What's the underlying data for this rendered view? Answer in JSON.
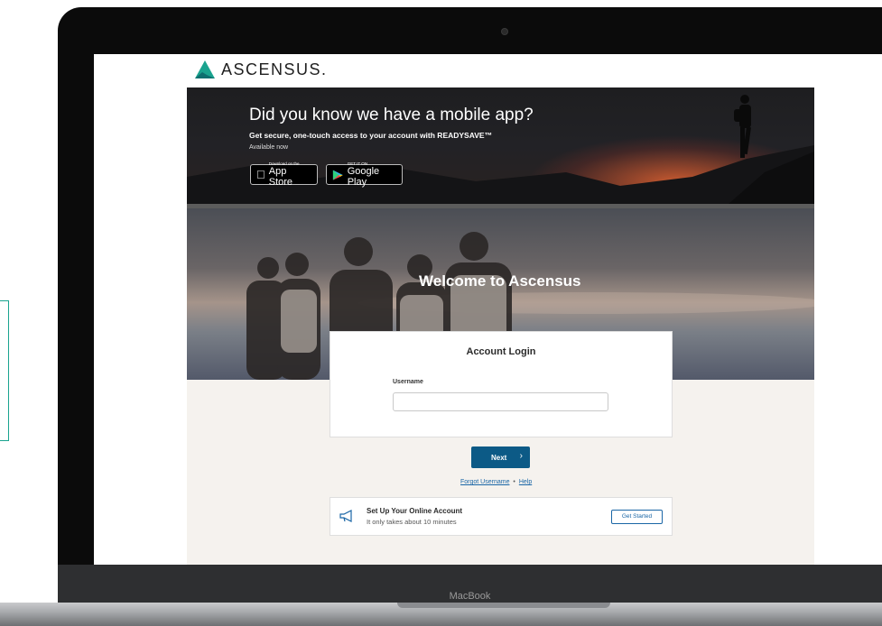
{
  "brand": {
    "name": "ASCENSUS."
  },
  "banner": {
    "title": "Did you know we have a mobile app?",
    "subtitle": "Get secure, one-touch access to your account with READYSAVE™",
    "availability": "Available now",
    "app_store": {
      "small": "Download on the",
      "big": "App Store"
    },
    "google_play": {
      "small": "GET IT ON",
      "big": "Google Play"
    }
  },
  "hero": {
    "title": "Welcome to Ascensus"
  },
  "login": {
    "title": "Account Login",
    "username_label": "Username",
    "username_value": "",
    "next_label": "Next",
    "next_chevron": "›",
    "forgot_username": "Forgot Username",
    "separator": "•",
    "help": "Help"
  },
  "setup": {
    "title": "Set Up Your Online Account",
    "subtitle": "It only takes about 10 minutes",
    "button": "Get Started"
  },
  "device": {
    "label": "MacBook"
  },
  "colors": {
    "brand_green": "#1aa38f",
    "primary_blue": "#0c5a86",
    "link_blue": "#1a66a6"
  }
}
